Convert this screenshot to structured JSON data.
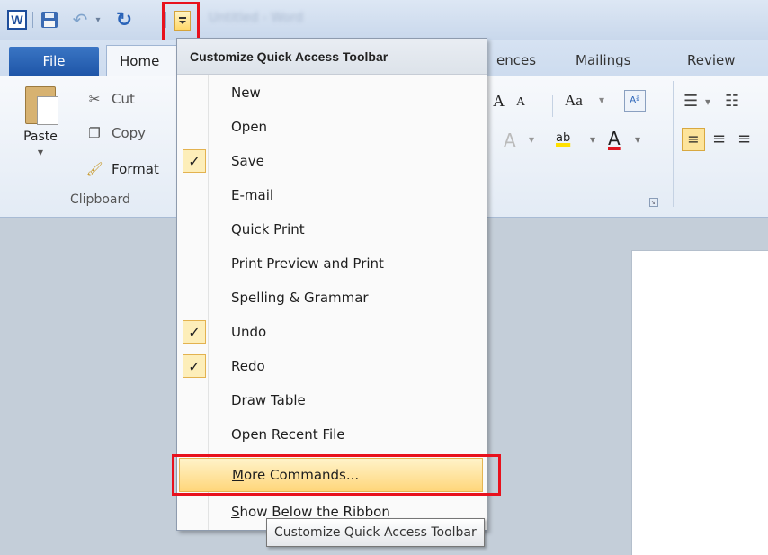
{
  "titlebar": {
    "app_icon_letter": "W",
    "title": "Untitled - Word"
  },
  "tabs": {
    "file": "File",
    "home": "Home",
    "references_partial": "ences",
    "mailings": "Mailings",
    "review": "Review"
  },
  "clipboard": {
    "paste": "Paste",
    "cut": "Cut",
    "copy": "Copy",
    "format": "Format",
    "group_label": "Clipboard"
  },
  "font_group": {
    "grow": "A",
    "shrink": "A",
    "change_case": "Aa",
    "highlight": "ab",
    "font_color": "A"
  },
  "menu": {
    "header": "Customize Quick Access Toolbar",
    "items": [
      {
        "label": "New",
        "checked": false
      },
      {
        "label": "Open",
        "checked": false
      },
      {
        "label": "Save",
        "checked": true
      },
      {
        "label": "E-mail",
        "checked": false
      },
      {
        "label": "Quick Print",
        "checked": false
      },
      {
        "label": "Print Preview and Print",
        "checked": false
      },
      {
        "label": "Spelling & Grammar",
        "checked": false
      },
      {
        "label": "Undo",
        "checked": true
      },
      {
        "label": "Redo",
        "checked": true
      },
      {
        "label": "Draw Table",
        "checked": false
      },
      {
        "label": "Open Recent File",
        "checked": false
      }
    ],
    "more_commands_mnemonic": "M",
    "more_commands_rest": "ore Commands...",
    "show_below_mnemonic": "S",
    "show_below_rest": "how Below the Ribbon",
    "check_glyph": "✓"
  },
  "tooltip": "Customize Quick Access Toolbar",
  "colors": {
    "highlight_box": "#e8111d",
    "menu_hover": "#ffd67a",
    "file_tab": "#2a63b8"
  }
}
